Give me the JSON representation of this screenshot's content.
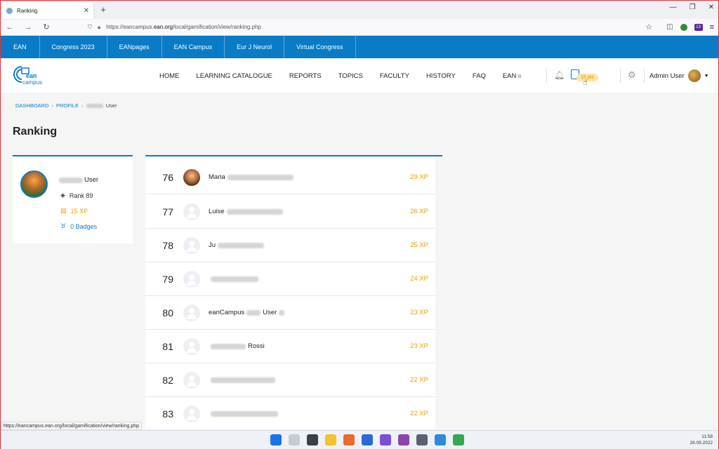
{
  "browser": {
    "tab_title": "Ranking",
    "url_prefix": "https://eancampus.",
    "url_domain": "ean.org",
    "url_path": "/local/gamification/view/ranking.php",
    "ext_badge": "13"
  },
  "topbar": {
    "items": [
      "EAN",
      "Congress 2023",
      "EANpages",
      "EAN Campus",
      "Eur J Neurol",
      "Virtual Congress"
    ]
  },
  "logo": {
    "line1": "ean",
    "line2": "campus"
  },
  "mainnav": {
    "items": [
      "HOME",
      "LEARNING CATALOGUE",
      "REPORTS",
      "TOPICS",
      "FACULTY",
      "HISTORY",
      "FAQ",
      "EAN"
    ]
  },
  "header": {
    "points_badge": "15 pts",
    "user_name": "Admin User"
  },
  "breadcrumb": {
    "dashboard": "DASHBOARD",
    "profile": "PROFILE",
    "current_suffix": "User"
  },
  "page": {
    "title": "Ranking"
  },
  "profile": {
    "name_suffix": "User",
    "rank": "Rank 89",
    "xp": "15 XP",
    "badges": "0 Badges"
  },
  "ranking": [
    {
      "rank": "76",
      "name": "Maria",
      "xp": "29 XP"
    },
    {
      "rank": "77",
      "name": "Luise",
      "xp": "26 XP"
    },
    {
      "rank": "78",
      "name": "Ju",
      "xp": "25 XP"
    },
    {
      "rank": "79",
      "name": "",
      "xp": "24 XP"
    },
    {
      "rank": "80",
      "name": "eanCampus",
      "name_suffix": "User",
      "xp": "23 XP"
    },
    {
      "rank": "81",
      "name": "",
      "name_suffix": "Rossi",
      "xp": "23 XP"
    },
    {
      "rank": "82",
      "name": "",
      "xp": "22 XP"
    },
    {
      "rank": "83",
      "name": "",
      "xp": "22 XP"
    }
  ],
  "status_url": "https://eancampus.ean.org/local/gamification/view/ranking.php",
  "clock": {
    "time": "11:58",
    "date": "26.09.2022"
  }
}
